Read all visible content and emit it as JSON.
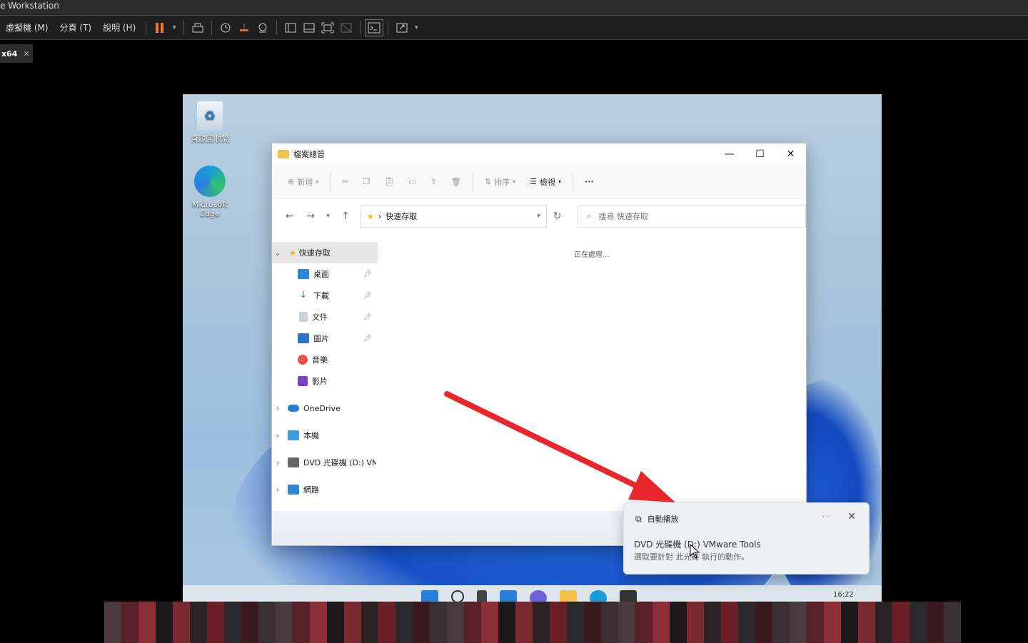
{
  "window": {
    "title": "e Workstation"
  },
  "menu": {
    "items": [
      "虛擬機 (M)",
      "分頁 (T)",
      "說明 (H)"
    ]
  },
  "tab": {
    "label": "x64",
    "close": "✕"
  },
  "desktop": {
    "icons": [
      {
        "label": "資源回收筒"
      },
      {
        "label_line1": "Microsoft",
        "label_line2": "Edge"
      }
    ]
  },
  "explorer": {
    "title": "檔案總管",
    "minimize": "—",
    "maximize": "☐",
    "close": "✕",
    "commands": {
      "new": "新增",
      "sort": "排序",
      "view": "檢視",
      "more": "···"
    },
    "address": {
      "path": "快速存取",
      "separator": "›"
    },
    "search": {
      "placeholder": "搜尋 快速存取"
    },
    "status": "正在處理...",
    "nav": {
      "quick_access": "快速存取",
      "pinned": [
        {
          "label": "桌面",
          "color": "#2f86d6"
        },
        {
          "label": "下載",
          "color": "#1f9a4a"
        },
        {
          "label": "文件",
          "color": "#8a95a3"
        },
        {
          "label": "圖片",
          "color": "#2a74c8"
        },
        {
          "label": "音樂",
          "color": "#e0584a"
        },
        {
          "label": "影片",
          "color": "#7b3fbf"
        }
      ],
      "onedrive": "OneDrive",
      "this_pc": "本機",
      "dvd": "DVD 光碟機 (D:) VM",
      "network": "網路"
    }
  },
  "toast": {
    "app": "自動播放",
    "more": "···",
    "close": "✕",
    "line1": "DVD 光碟機 (D:) VMware Tools",
    "line2": "選取要針對 此光碟 執行的動作。"
  },
  "taskbar": {
    "time": "16:22"
  },
  "colors": {
    "arrow": "#e8262b",
    "accent": "#1a5fd0",
    "pause": "#f07a1e"
  }
}
